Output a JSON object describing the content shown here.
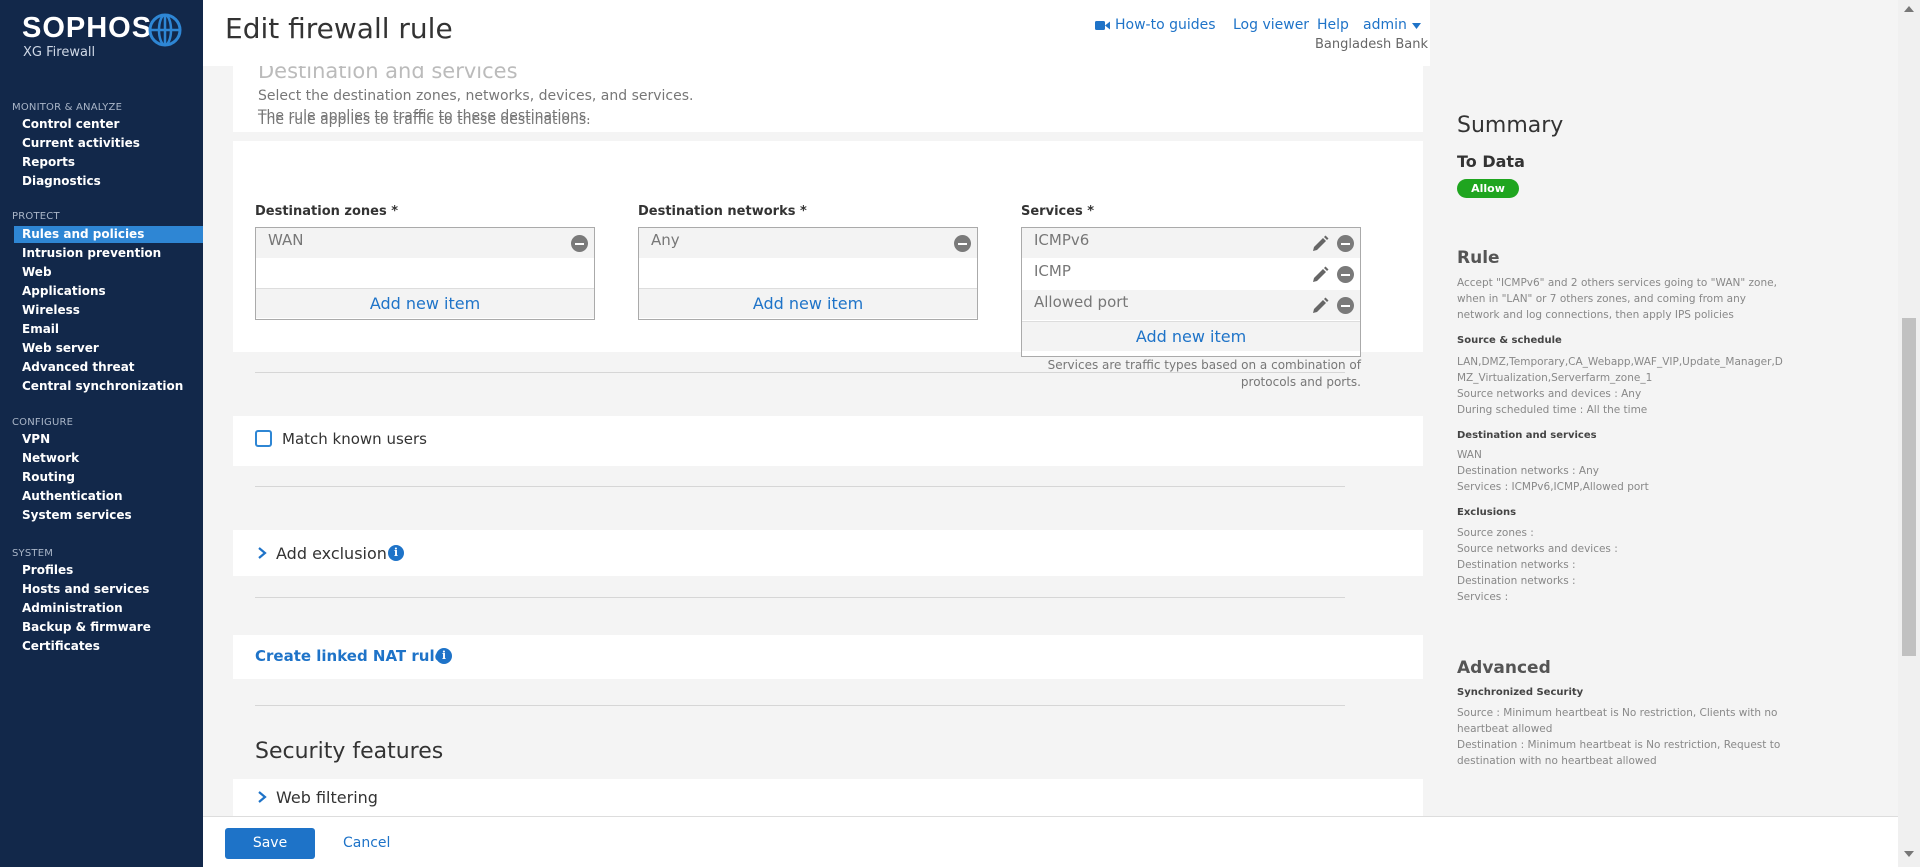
{
  "sidebar": {
    "logo": "SOPHOS",
    "product": "XG Firewall",
    "sections": [
      {
        "title": "MONITOR & ANALYZE",
        "items": [
          "Control center",
          "Current activities",
          "Reports",
          "Diagnostics"
        ]
      },
      {
        "title": "PROTECT",
        "items": [
          "Rules and policies",
          "Intrusion prevention",
          "Web",
          "Applications",
          "Wireless",
          "Email",
          "Web server",
          "Advanced threat",
          "Central synchronization"
        ]
      },
      {
        "title": "CONFIGURE",
        "items": [
          "VPN",
          "Network",
          "Routing",
          "Authentication",
          "System services"
        ]
      },
      {
        "title": "SYSTEM",
        "items": [
          "Profiles",
          "Hosts and services",
          "Administration",
          "Backup & firmware",
          "Certificates"
        ]
      }
    ],
    "active_item": "Rules and policies"
  },
  "header": {
    "title": "Edit firewall rule",
    "links": {
      "howto": "How-to guides",
      "logviewer": "Log viewer",
      "help": "Help",
      "admin": "admin"
    },
    "organization": "Bangladesh Bank"
  },
  "destination": {
    "heading": "Destination and services",
    "desc1": "Select the destination zones, networks, devices, and services.",
    "desc2": "The rule applies to traffic to these destinations.",
    "zones_label": "Destination zones *",
    "zones": [
      "WAN"
    ],
    "networks_label": "Destination networks *",
    "networks": [
      "Any"
    ],
    "services_label": "Services *",
    "services": [
      "ICMPv6",
      "ICMP",
      "Allowed port"
    ],
    "add_label": "Add new item",
    "services_hint_1": "Services are traffic types based on a combination of",
    "services_hint_2": "protocols and ports."
  },
  "match_users": {
    "label": "Match known users",
    "checked": false
  },
  "exclusion": {
    "label": "Add exclusion"
  },
  "nat": {
    "label": "Create linked NAT rule"
  },
  "security": {
    "title": "Security features",
    "web_filtering": "Web filtering"
  },
  "footer": {
    "save": "Save",
    "cancel": "Cancel"
  },
  "summary": {
    "title": "Summary",
    "rule_name": "To Data",
    "action": "Allow",
    "rule_heading": "Rule",
    "rule_text": [
      "Accept \"ICMPv6\" and 2 others services going to \"WAN\" zone,",
      "when in \"LAN\" or 7 others zones, and coming from any",
      "network and log connections, then apply IPS policies"
    ],
    "source_heading": "Source & schedule",
    "source_text": [
      "LAN,DMZ,Temporary,CA_Webapp,WAF_VIP,Update_Manager,D",
      "MZ_Virtualization,Serverfarm_zone_1",
      "Source networks and devices : Any",
      "During scheduled time : All the time"
    ],
    "dest_heading": "Destination and services",
    "dest_text": [
      "WAN",
      "Destination networks : Any",
      "Services : ICMPv6,ICMP,Allowed port"
    ],
    "excl_heading": "Exclusions",
    "excl_text": [
      "Source zones :",
      "Source networks and devices :",
      "Destination networks :",
      "Destination networks :",
      "Services :"
    ],
    "advanced_heading": "Advanced",
    "sync_heading": "Synchronized Security",
    "sync_text": [
      "Source : Minimum heartbeat is No restriction, Clients with no",
      "heartbeat allowed",
      "Destination : Minimum heartbeat is No restriction, Request to",
      "destination with no heartbeat allowed"
    ]
  },
  "colors": {
    "sidebar_bg": "#12284a",
    "active_bg": "#2e86d4",
    "link": "#1e73c8",
    "allow": "#1fa51f"
  }
}
